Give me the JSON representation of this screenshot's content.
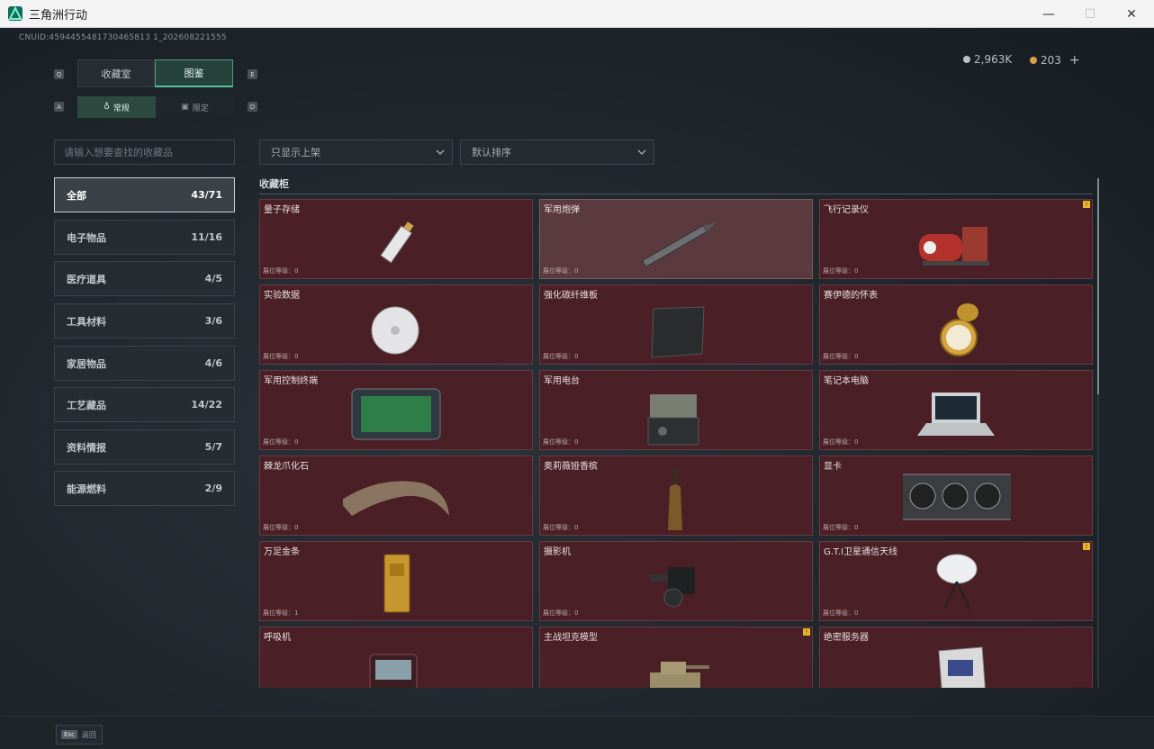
{
  "window": {
    "title": "三角洲行动",
    "minimize": "—",
    "maximize": "☐",
    "close": "✕"
  },
  "header": {
    "uid": "CNUID:4594455481730465813 1_202608221555",
    "currency": [
      {
        "value": "2,963K",
        "color": "#b9c0c6",
        "icon": "silver-coin-icon"
      },
      {
        "value": "203",
        "color": "#d7a24c",
        "icon": "gold-coin-icon"
      }
    ],
    "add": "+"
  },
  "tabs": {
    "left_key": "Q",
    "right_key": "E",
    "items": [
      {
        "label": "收藏室",
        "active": false
      },
      {
        "label": "图鉴",
        "active": true
      }
    ]
  },
  "subtabs": {
    "left_key": "A",
    "right_key": "D",
    "items": [
      {
        "label": "常规",
        "icon": "flask-icon",
        "active": true
      },
      {
        "label": "限定",
        "icon": "frame-icon",
        "active": false
      }
    ]
  },
  "search": {
    "placeholder": "请输入想要查找的收藏品"
  },
  "filters": [
    {
      "label": "只显示上架"
    },
    {
      "label": "默认排序"
    }
  ],
  "categories": [
    {
      "label": "全部",
      "count": "43/71",
      "active": true
    },
    {
      "label": "电子物品",
      "count": "11/16",
      "active": false
    },
    {
      "label": "医疗道具",
      "count": "4/5",
      "active": false
    },
    {
      "label": "工具材料",
      "count": "3/6",
      "active": false
    },
    {
      "label": "家居物品",
      "count": "4/6",
      "active": false
    },
    {
      "label": "工艺藏品",
      "count": "14/22",
      "active": false
    },
    {
      "label": "资料情报",
      "count": "5/7",
      "active": false
    },
    {
      "label": "能源燃料",
      "count": "2/9",
      "active": false
    }
  ],
  "section": {
    "title": "收藏柜"
  },
  "items": [
    {
      "name": "量子存储",
      "level": "展位等级：0",
      "icon": "usb-drive-icon",
      "badge": false,
      "highlight": false
    },
    {
      "name": "军用炮弹",
      "level": "展位等级：0",
      "icon": "artillery-shell-icon",
      "badge": false,
      "highlight": true
    },
    {
      "name": "飞行记录仪",
      "level": "展位等级：0",
      "icon": "flight-recorder-icon",
      "badge": true,
      "highlight": false
    },
    {
      "name": "实验数据",
      "level": "展位等级：0",
      "icon": "data-disc-icon",
      "badge": false,
      "highlight": false
    },
    {
      "name": "强化碳纤维板",
      "level": "展位等级：0",
      "icon": "carbon-plate-icon",
      "badge": false,
      "highlight": false
    },
    {
      "name": "赛伊德的怀表",
      "level": "展位等级：0",
      "icon": "pocket-watch-icon",
      "badge": false,
      "highlight": false
    },
    {
      "name": "军用控制终端",
      "level": "展位等级：0",
      "icon": "control-terminal-icon",
      "badge": false,
      "highlight": false
    },
    {
      "name": "军用电台",
      "level": "展位等级：0",
      "icon": "military-radio-icon",
      "badge": false,
      "highlight": false
    },
    {
      "name": "笔记本电脑",
      "level": "展位等级：0",
      "icon": "laptop-icon",
      "badge": false,
      "highlight": false
    },
    {
      "name": "棘龙爪化石",
      "level": "展位等级：0",
      "icon": "claw-fossil-icon",
      "badge": false,
      "highlight": false
    },
    {
      "name": "奥莉薇娅香槟",
      "level": "展位等级：0",
      "icon": "champagne-bottle-icon",
      "badge": false,
      "highlight": false
    },
    {
      "name": "显卡",
      "level": "展位等级：0",
      "icon": "graphics-card-icon",
      "badge": false,
      "highlight": false
    },
    {
      "name": "万足金条",
      "level": "展位等级：1",
      "icon": "gold-bar-icon",
      "badge": false,
      "highlight": false
    },
    {
      "name": "摄影机",
      "level": "展位等级：0",
      "icon": "video-camera-icon",
      "badge": false,
      "highlight": false
    },
    {
      "name": "G.T.I卫星通信天线",
      "level": "展位等级：0",
      "icon": "satellite-dish-icon",
      "badge": true,
      "highlight": false
    },
    {
      "name": "呼吸机",
      "level": "",
      "icon": "ventilator-icon",
      "badge": false,
      "highlight": false
    },
    {
      "name": "主战坦克模型",
      "level": "",
      "icon": "tank-model-icon",
      "badge": true,
      "highlight": false
    },
    {
      "name": "绝密服务器",
      "level": "",
      "icon": "server-board-icon",
      "badge": false,
      "highlight": false
    }
  ],
  "footer": {
    "key": "Esc",
    "label": "返回"
  }
}
